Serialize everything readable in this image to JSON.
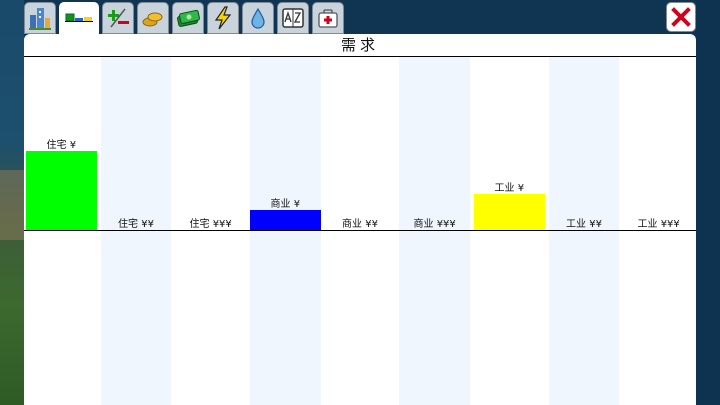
{
  "tabs": [
    {
      "name": "tab-city-stats",
      "icon": "city-buildings-icon",
      "active": false
    },
    {
      "name": "tab-demand",
      "icon": "demand-bars-icon",
      "active": true
    },
    {
      "name": "tab-budget",
      "icon": "plus-minus-icon",
      "active": false
    },
    {
      "name": "tab-taxes",
      "icon": "coins-icon",
      "active": false
    },
    {
      "name": "tab-finance",
      "icon": "money-bills-icon",
      "active": false
    },
    {
      "name": "tab-power",
      "icon": "lightning-icon",
      "active": false
    },
    {
      "name": "tab-water",
      "icon": "water-drop-icon",
      "active": false
    },
    {
      "name": "tab-dictionary",
      "icon": "az-book-icon",
      "active": false
    },
    {
      "name": "tab-health",
      "icon": "first-aid-kit-icon",
      "active": false
    }
  ],
  "close_icon": "close-x-icon",
  "panel": {
    "title": "需求"
  },
  "colors": {
    "residential": "#00ff00",
    "commercial": "#0000ff",
    "industrial": "#ffff00",
    "column_stripe": "#f0f6fd",
    "close_red": "#d0021b"
  },
  "chart_data": {
    "type": "bar",
    "categories": [
      "住宅 ¥",
      "住宅 ¥¥",
      "住宅 ¥¥¥",
      "商业 ¥",
      "商业 ¥¥",
      "商业 ¥¥¥",
      "工业 ¥",
      "工业 ¥¥",
      "工业 ¥¥¥"
    ],
    "values": [
      10,
      0,
      0,
      2.5,
      0,
      0,
      4.5,
      0,
      0
    ],
    "bar_colors": [
      "#00ff00",
      "#00ff00",
      "#00ff00",
      "#0000ff",
      "#0000ff",
      "#0000ff",
      "#ffff00",
      "#ffff00",
      "#ffff00"
    ],
    "ylim": [
      -10,
      10
    ],
    "title": "需求",
    "xlabel": "",
    "ylabel": "",
    "grid": false,
    "legend": "none"
  }
}
